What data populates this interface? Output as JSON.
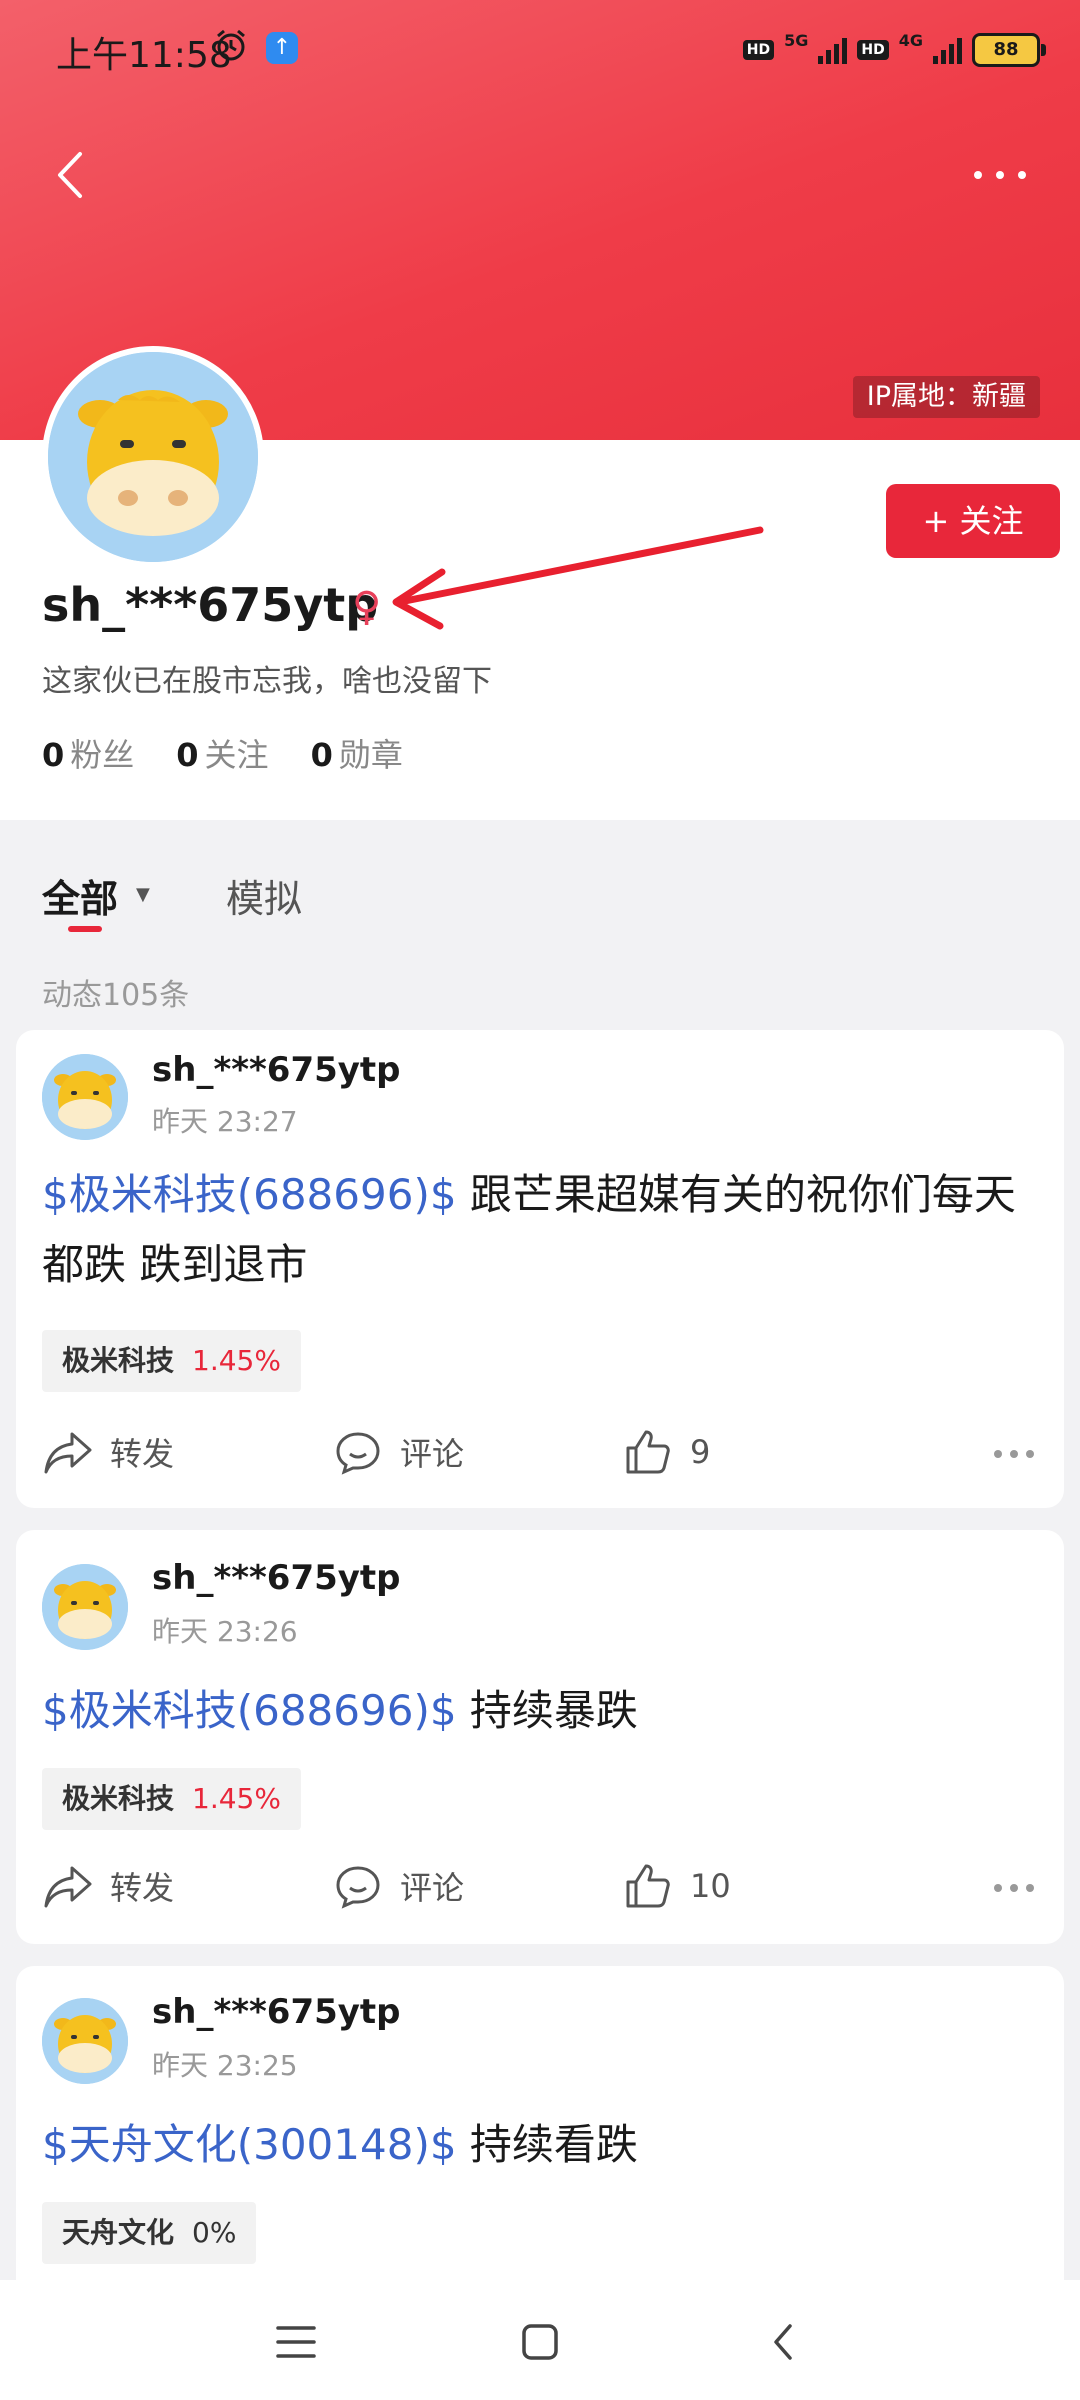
{
  "status_bar": {
    "time": "上午11:58",
    "hd1": "HD",
    "net1": "5G",
    "hd2": "HD",
    "net2": "4G",
    "battery": "88"
  },
  "header": {
    "ip_location": "IP属地：新疆"
  },
  "profile": {
    "username": "sh_***675ytp",
    "gender_symbol": "♀",
    "bio": "这家伙已在股市忘我，啥也没留下",
    "follow_label": "关注",
    "follow_plus": "+",
    "stats": [
      {
        "value": "0",
        "label": "粉丝"
      },
      {
        "value": "0",
        "label": "关注"
      },
      {
        "value": "0",
        "label": "勋章"
      }
    ]
  },
  "tabs": {
    "all": "全部",
    "simulated": "模拟",
    "post_count": "动态105条"
  },
  "actions": {
    "repost": "转发",
    "comment": "评论"
  },
  "posts": [
    {
      "author": "sh_***675ytp",
      "time": "昨天 23:27",
      "stock_link": "$极米科技(688696)$",
      "text": " 跟芒果超媒有关的祝你们每天都跌 跌到退市",
      "tag_name": "极米科技",
      "tag_change": "1.45%",
      "likes": "9"
    },
    {
      "author": "sh_***675ytp",
      "time": "昨天 23:26",
      "stock_link": "$极米科技(688696)$",
      "text": " 持续暴跌",
      "tag_name": "极米科技",
      "tag_change": "1.45%",
      "likes": "10"
    },
    {
      "author": "sh_***675ytp",
      "time": "昨天 23:25",
      "stock_link": "$天舟文化(300148)$",
      "text": " 持续看跌",
      "tag_name": "天舟文化",
      "tag_change": "0%"
    }
  ],
  "colors": {
    "brand_red": "#e8273a",
    "stock_blue": "#3a64c9",
    "avatar_bg": "#a8d3f3"
  }
}
